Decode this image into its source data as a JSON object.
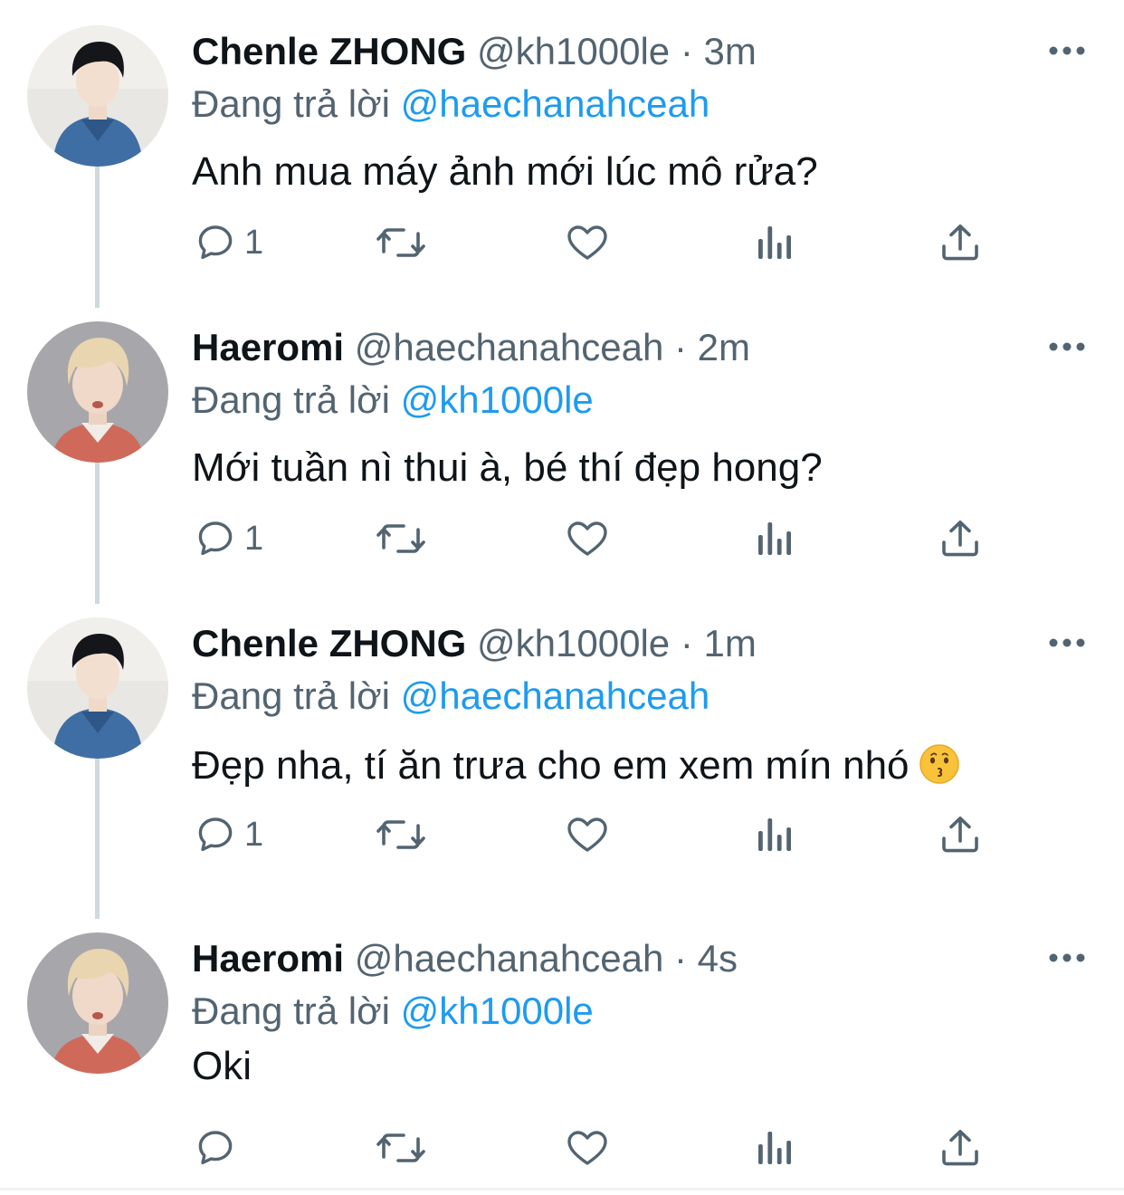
{
  "tweets": [
    {
      "name": "Chenle ZHONG",
      "handle": "@kh1000le",
      "separator": "·",
      "time": "3m",
      "replying_label": "Đang trả lời",
      "replying_to": "@haechanahceah",
      "text": "Anh mua máy ảnh mới lúc mô rửa?",
      "reply_count": "1",
      "avatar": "avatar-chenle"
    },
    {
      "name": "Haeromi",
      "handle": "@haechanahceah",
      "separator": "·",
      "time": "2m",
      "replying_label": "Đang trả lời",
      "replying_to": "@kh1000le",
      "text": "Mới tuần nì thui à, bé thí đẹp hong?",
      "reply_count": "1",
      "avatar": "avatar-haeromi"
    },
    {
      "name": "Chenle ZHONG",
      "handle": "@kh1000le",
      "separator": "·",
      "time": "1m",
      "replying_label": "Đang trả lời",
      "replying_to": "@haechanahceah",
      "text": "Đẹp nha, tí ăn trưa cho em xem mín nhó",
      "emoji": "kissing-face-emoji",
      "reply_count": "1",
      "avatar": "avatar-chenle"
    },
    {
      "name": "Haeromi",
      "handle": "@haechanahceah",
      "separator": "·",
      "time": "4s",
      "replying_label": "Đang trả lời",
      "replying_to": "@kh1000le",
      "text": "Oki",
      "reply_count": "",
      "avatar": "avatar-haeromi"
    }
  ],
  "icons": {
    "more": "more-icon",
    "reply": "reply-icon",
    "retweet": "retweet-icon",
    "like": "heart-icon",
    "views": "views-icon",
    "share": "share-icon"
  },
  "colors": {
    "text_primary": "#0f1419",
    "text_secondary": "#536471",
    "accent": "#1d9bf0",
    "thread_line": "#cfd9de"
  }
}
